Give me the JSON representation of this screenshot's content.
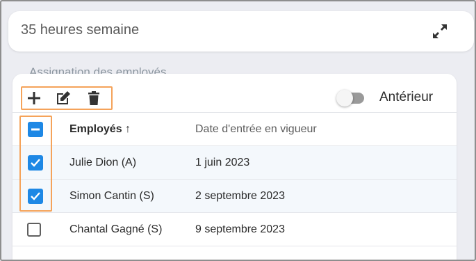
{
  "header": {
    "title": "35 heures semaine",
    "expand_icon": "expand-diagonal-icon"
  },
  "section": {
    "label": "Assignation des employés"
  },
  "toolbar": {
    "add_icon": "plus-icon",
    "edit_icon": "edit-icon",
    "delete_icon": "trash-icon",
    "toggle_label": "Antérieur",
    "toggle_on": false
  },
  "table": {
    "columns": [
      "Employés ↑",
      "Date d'entrée en vigueur"
    ],
    "rows": [
      {
        "name": "Julie Dion (A)",
        "date": "1 juin 2023",
        "checked": true
      },
      {
        "name": "Simon Cantin (S)",
        "date": "2 septembre 2023",
        "checked": true
      },
      {
        "name": "Chantal Gagné (S)",
        "date": "9 septembre 2023",
        "checked": false
      }
    ]
  },
  "colors": {
    "accent": "#1e88e5",
    "highlight": "#f5a35a"
  }
}
